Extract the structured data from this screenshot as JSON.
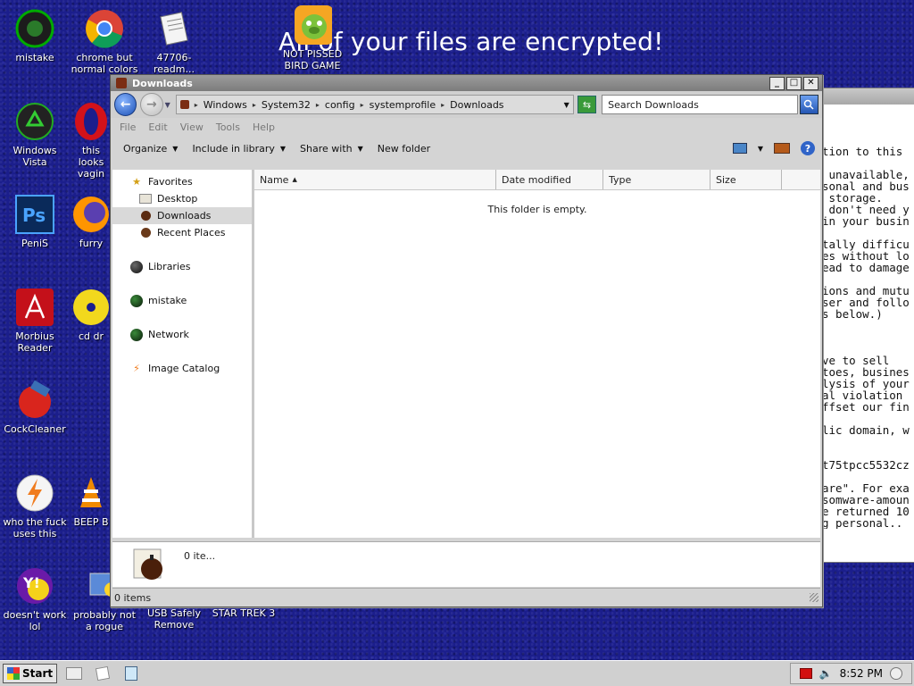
{
  "desktop": {
    "headline": "All of your files are encrypted!",
    "icons": [
      {
        "label": "mistake"
      },
      {
        "label": "chrome but normal colors"
      },
      {
        "label": "47706-readm..."
      },
      {
        "label": "NOT PISSED BIRD GAME"
      },
      {
        "label": "Windows Vista"
      },
      {
        "label": "this looks vagin"
      },
      {
        "label": "PeniS"
      },
      {
        "label": "furry"
      },
      {
        "label": "Morbius Reader"
      },
      {
        "label": "cd dr"
      },
      {
        "label": "CockCleaner"
      },
      {
        "label": "who the fuck uses this"
      },
      {
        "label": "BEEP B"
      },
      {
        "label": "doesn't work lol"
      },
      {
        "label": "probably not a rogue"
      },
      {
        "label": "USB Safely Remove"
      },
      {
        "label": "STAR TREK 3"
      }
    ]
  },
  "notepad": {
    "lines": "tion to this\n\n unavailable,\nsonal and bus\n storage.\n don't need y\nin your busin\n\ntally difficu\nes without lo\nead to damage\n\nions and mutu\nser and follo\ns below.)\n\n\n\nve to sell\ntoes, busines\nlysis of your\nal violation\nffset our fin\n\nlic domain, w\n\n\nt75tpcc5532cz\n\nare\". For exa\nsomware-amoun\ne returned 10\ng personal.."
  },
  "window": {
    "title": "Downloads",
    "breadcrumb": [
      "Windows",
      "System32",
      "config",
      "systemprofile",
      "Downloads"
    ],
    "search_placeholder": "Search Downloads",
    "menu": [
      "File",
      "Edit",
      "View",
      "Tools",
      "Help"
    ],
    "toolbar": {
      "organize": "Organize",
      "include_in_library": "Include in library",
      "share_with": "Share with",
      "new_folder": "New folder"
    },
    "nav": {
      "favorites": "Favorites",
      "desktop": "Desktop",
      "downloads": "Downloads",
      "recent_places": "Recent Places",
      "libraries": "Libraries",
      "mistake": "mistake",
      "network": "Network",
      "image_catalog": "Image Catalog"
    },
    "columns": [
      "Name",
      "Date modified",
      "Type",
      "Size"
    ],
    "empty_message": "This folder is empty.",
    "details_text": "0 ite...",
    "status_text": "0 items"
  },
  "taskbar": {
    "start_label": "Start",
    "clock": "8:52 PM"
  },
  "colors": {
    "desktop_bg": "#1b1e8c",
    "titlebar": "#8c8c8c",
    "selection": "#d9d9d9"
  }
}
